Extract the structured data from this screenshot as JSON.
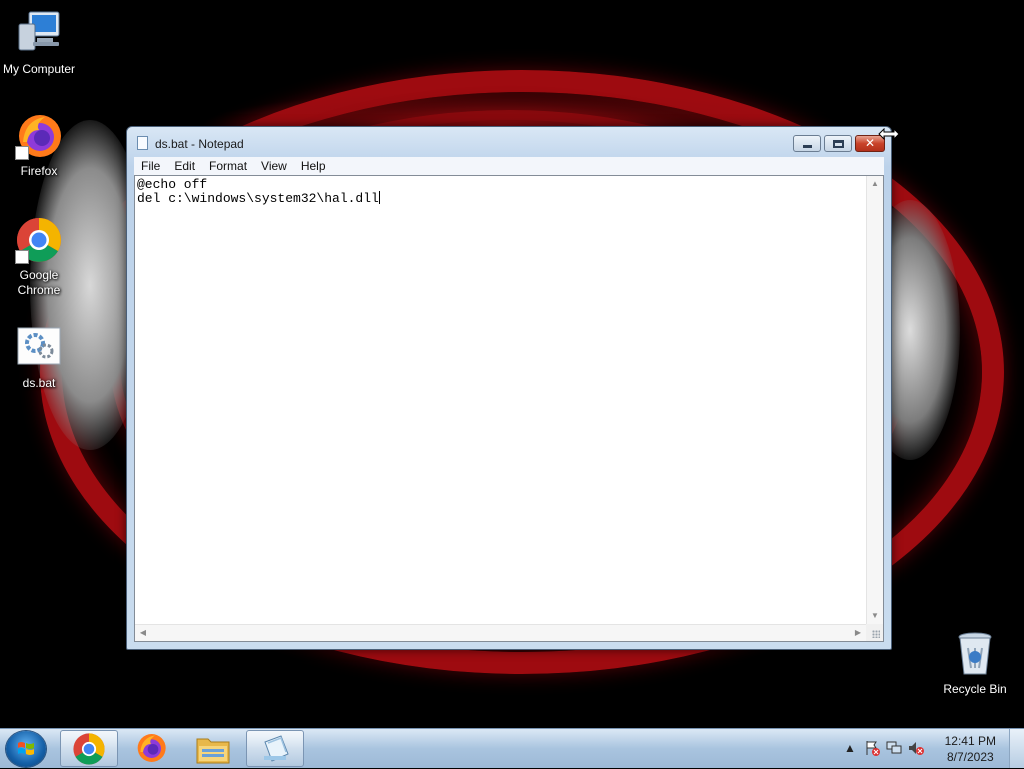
{
  "desktop": {
    "icons": [
      {
        "label": "My Computer",
        "icon": "computer-icon"
      },
      {
        "label": "Firefox",
        "icon": "firefox-icon"
      },
      {
        "label": "Google Chrome",
        "icon": "chrome-icon"
      },
      {
        "label": "ds.bat",
        "icon": "batch-file-icon"
      },
      {
        "label": "Recycle Bin",
        "icon": "recycle-bin-icon"
      }
    ]
  },
  "window": {
    "title": "ds.bat - Notepad",
    "menu": [
      "File",
      "Edit",
      "Format",
      "View",
      "Help"
    ],
    "content_lines": [
      "@echo off",
      "del c:\\windows\\system32\\hal.dll"
    ],
    "close_label": "✕",
    "minimize_icon": "minimize-icon",
    "maximize_icon": "maximize-icon"
  },
  "taskbar": {
    "pinned": [
      {
        "name": "chrome",
        "icon": "chrome-icon"
      },
      {
        "name": "firefox",
        "icon": "firefox-icon"
      },
      {
        "name": "explorer",
        "icon": "folder-icon"
      },
      {
        "name": "notepad",
        "icon": "notepad-icon",
        "active": true
      }
    ],
    "tray": {
      "time": "12:41 PM",
      "date": "8/7/2023",
      "icons": [
        "show-hidden-icons",
        "action-center-icon",
        "network-icon",
        "volume-muted-icon"
      ]
    }
  },
  "colors": {
    "wallpaper_accent": "#b40d12",
    "taskbar": "#a9c4df",
    "close_button": "#c9432a"
  }
}
